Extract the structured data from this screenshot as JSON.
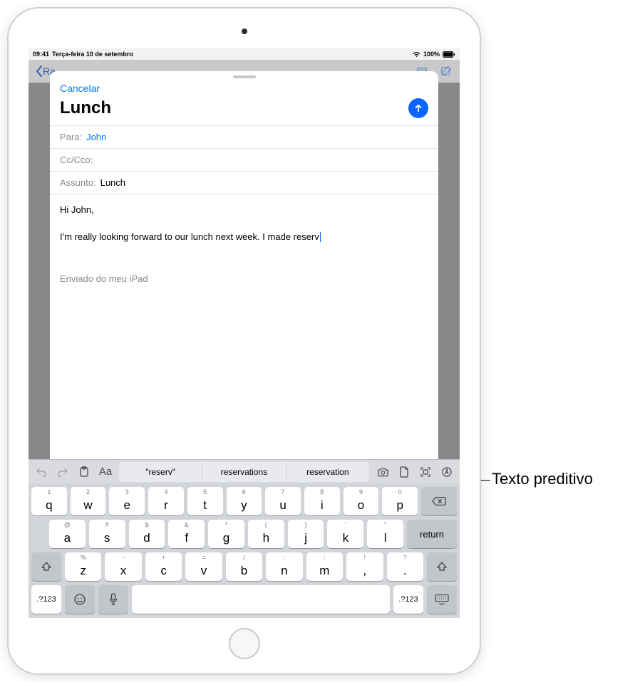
{
  "annotation": "Texto preditivo",
  "status": {
    "time": "09:41",
    "date": "Terça-feira 10 de setembro",
    "battery": "100%"
  },
  "dimmed": {
    "back": "Ra"
  },
  "compose": {
    "cancel": "Cancelar",
    "title": "Lunch",
    "to_label": "Para:",
    "to_value": "John",
    "cc_label": "Cc/Cco:",
    "subject_label": "Assunto:",
    "subject_value": "Lunch",
    "body_greeting": "Hi John,",
    "body_line": "I'm really looking forward to our lunch next week. I made reserv",
    "signature": "Enviado do meu iPad"
  },
  "shortcut": {
    "aa": "Aa"
  },
  "predictive": [
    "\"reserv\"",
    "reservations",
    "reservation"
  ],
  "keys": {
    "row1": [
      {
        "main": "q",
        "alt": "1"
      },
      {
        "main": "w",
        "alt": "2"
      },
      {
        "main": "e",
        "alt": "3"
      },
      {
        "main": "r",
        "alt": "4"
      },
      {
        "main": "t",
        "alt": "5"
      },
      {
        "main": "y",
        "alt": "6"
      },
      {
        "main": "u",
        "alt": "7"
      },
      {
        "main": "i",
        "alt": "8"
      },
      {
        "main": "o",
        "alt": "9"
      },
      {
        "main": "p",
        "alt": "0"
      }
    ],
    "row2": [
      {
        "main": "a",
        "alt": "@"
      },
      {
        "main": "s",
        "alt": "#"
      },
      {
        "main": "d",
        "alt": "$"
      },
      {
        "main": "f",
        "alt": "&"
      },
      {
        "main": "g",
        "alt": "*"
      },
      {
        "main": "h",
        "alt": "("
      },
      {
        "main": "j",
        "alt": ")"
      },
      {
        "main": "k",
        "alt": "'"
      },
      {
        "main": "l",
        "alt": "\""
      }
    ],
    "row3": [
      {
        "main": "z",
        "alt": "%"
      },
      {
        "main": "x",
        "alt": "-"
      },
      {
        "main": "c",
        "alt": "+"
      },
      {
        "main": "v",
        "alt": "="
      },
      {
        "main": "b",
        "alt": "/"
      },
      {
        "main": "n",
        "alt": ";"
      },
      {
        "main": "m",
        "alt": ":"
      },
      {
        "main": ",",
        "alt": "!"
      },
      {
        "main": ".",
        "alt": "?"
      }
    ],
    "return": "return",
    "numkey": ".?123"
  }
}
